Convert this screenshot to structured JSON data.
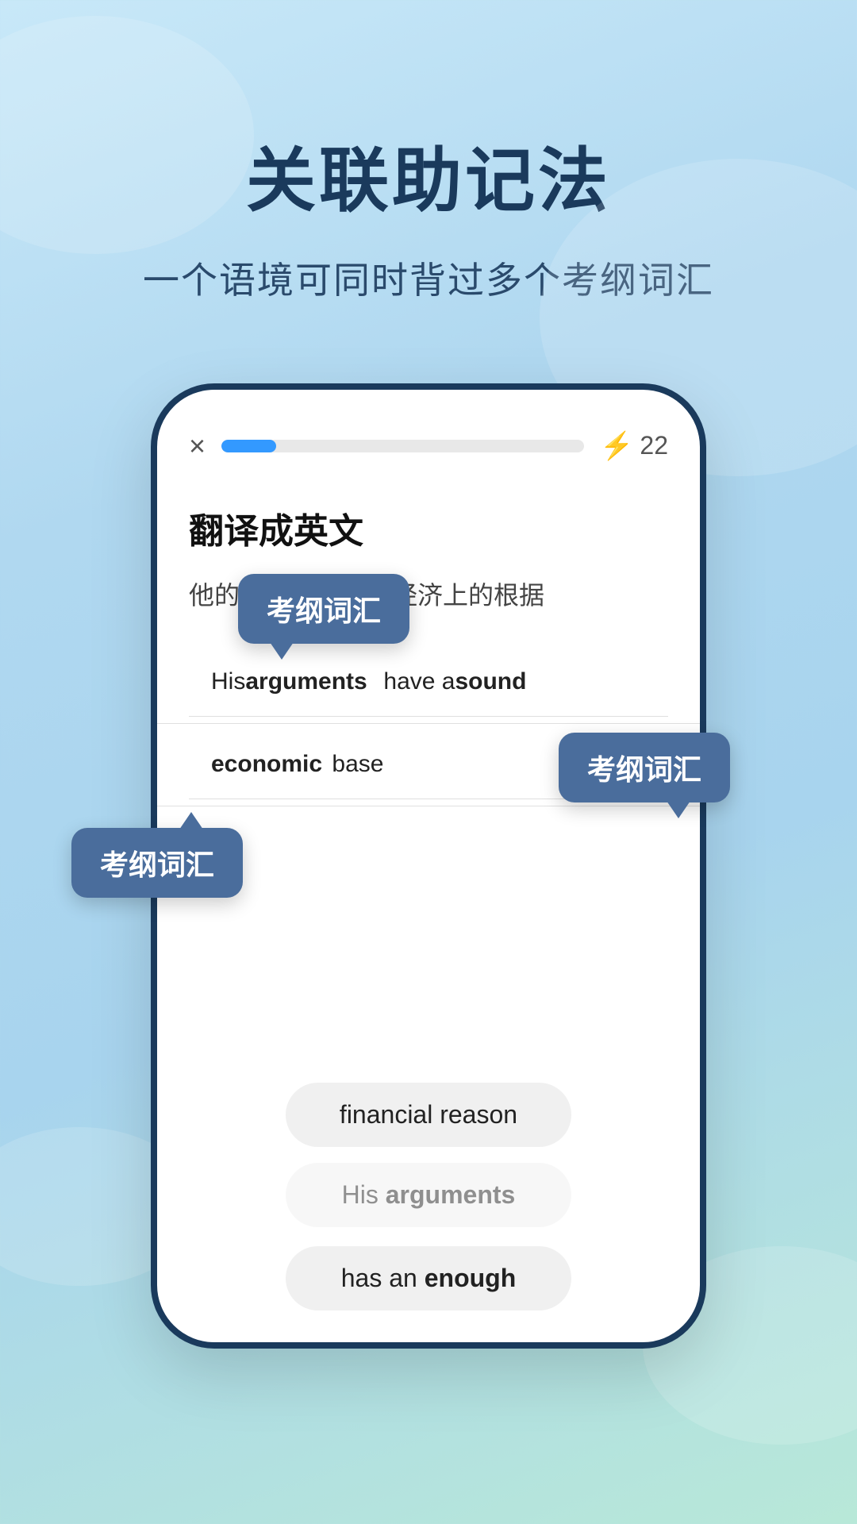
{
  "page": {
    "background_gradient": "linear-gradient(160deg, #c8e8f8 0%, #b0d8f0 30%, #a8d4ee 60%, #b8e8d8 100%)"
  },
  "title_section": {
    "main_title": "关联助记法",
    "subtitle": "一个语境可同时背过多个考纲词汇"
  },
  "phone": {
    "close_icon": "×",
    "score": "22",
    "lightning_icon": "⚡",
    "question_label": "翻译成英文",
    "question_text": "他的论点有充分的经济上的根据",
    "answer_rows": [
      {
        "parts": [
          {
            "text": "His ",
            "bold": false
          },
          {
            "text": "arguments",
            "bold": true
          },
          {
            "text": "  have a ",
            "bold": false
          },
          {
            "text": "sound",
            "bold": true
          }
        ]
      },
      {
        "parts": [
          {
            "text": "economic",
            "bold": true
          },
          {
            "text": " base",
            "bold": false
          }
        ]
      }
    ],
    "bottom_choices": [
      {
        "text": "financial reason",
        "bold_part": "financial",
        "greyed": false
      },
      {
        "text": "His arguments",
        "bold_part": "arguments",
        "greyed": true
      },
      {
        "text": "has an enough",
        "bold_part": "enough",
        "greyed": false
      }
    ]
  },
  "tooltips": [
    {
      "label": "考纲词汇",
      "position": "tooltip-1",
      "tail": "tail-bottom-left"
    },
    {
      "label": "考纲词汇",
      "position": "tooltip-2",
      "tail": "tail-bottom-right"
    },
    {
      "label": "考纲词汇",
      "position": "tooltip-3",
      "tail": "tail-top-right"
    }
  ]
}
